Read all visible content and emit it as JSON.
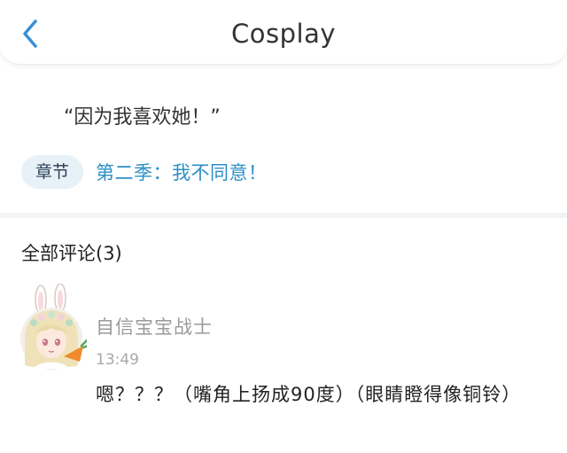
{
  "header": {
    "title": "Cosplay",
    "back_icon": "chevron-left-icon"
  },
  "post": {
    "quote": "“因为我喜欢她！”",
    "chapter_tag": "章节",
    "chapter_title": "第二季：我不同意！"
  },
  "comments": {
    "header": "全部评论(3)",
    "items": [
      {
        "username": "自信宝宝战士",
        "time": "13:49",
        "text": "嗯？？？（嘴角上扬成90度）（眼睛瞪得像铜铃）",
        "avatar_icon": "anime-girl-bunny-ears-avatar"
      }
    ]
  },
  "colors": {
    "accent": "#2d8fc7",
    "back_icon": "#3a8fd6",
    "tag_bg": "#e7f1f8",
    "muted": "#9a9a9a"
  }
}
